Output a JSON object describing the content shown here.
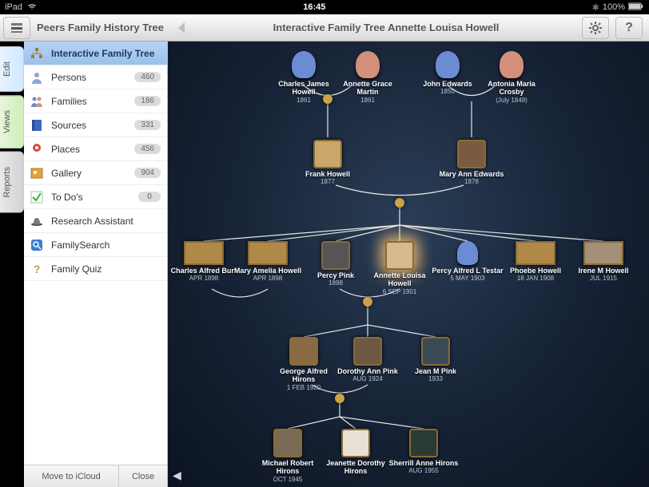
{
  "status": {
    "carrier": "iPad",
    "time": "16:45",
    "battery": "100%"
  },
  "toolbar": {
    "left_title": "Peers Family History Tree",
    "center_title": "Interactive Family Tree Annette Louisa Howell"
  },
  "sidetabs": [
    {
      "label": "Edit"
    },
    {
      "label": "Views"
    },
    {
      "label": "Reports"
    }
  ],
  "sidebar": {
    "items": [
      {
        "label": "Interactive Family Tree",
        "icon": "tree-icon",
        "badge": "",
        "selected": true
      },
      {
        "label": "Persons",
        "icon": "person-icon",
        "badge": "460",
        "selected": false
      },
      {
        "label": "Families",
        "icon": "people-icon",
        "badge": "186",
        "selected": false
      },
      {
        "label": "Sources",
        "icon": "book-icon",
        "badge": "331",
        "selected": false
      },
      {
        "label": "Places",
        "icon": "pin-icon",
        "badge": "456",
        "selected": false
      },
      {
        "label": "Gallery",
        "icon": "photo-icon",
        "badge": "904",
        "selected": false
      },
      {
        "label": "To Do's",
        "icon": "check-icon",
        "badge": "0",
        "selected": false
      },
      {
        "label": "Research Assistant",
        "icon": "hat-icon",
        "badge": "",
        "selected": false
      },
      {
        "label": "FamilySearch",
        "icon": "search-icon",
        "badge": "",
        "selected": false
      },
      {
        "label": "Family Quiz",
        "icon": "question-icon",
        "badge": "",
        "selected": false
      }
    ],
    "bottom": {
      "move": "Move to iCloud",
      "close": "Close"
    }
  },
  "tree": {
    "gen1": [
      {
        "name": "Charles James Howell",
        "date": "1861",
        "sex": "m"
      },
      {
        "name": "Annette Grace Martin",
        "date": "1861",
        "sex": "f"
      },
      {
        "name": "John Edwards",
        "date": "1850",
        "sex": "m"
      },
      {
        "name": "Antonia Maria Crosby",
        "date": "(July 1849)",
        "sex": "f"
      }
    ],
    "gen2": [
      {
        "name": "Frank Howell",
        "date": "1877"
      },
      {
        "name": "Mary Ann Edwards",
        "date": "1878"
      }
    ],
    "gen3": [
      {
        "name": "Charles Alfred Burr",
        "date": "APR 1898"
      },
      {
        "name": "Mary Amelia Howell",
        "date": "APR 1898"
      },
      {
        "name": "Percy Pink",
        "date": "1898"
      },
      {
        "name": "Annette Louisa Howell",
        "date": "6 SEP 1901"
      },
      {
        "name": "Percy Alfred L Testar",
        "date": "5 MAY 1903"
      },
      {
        "name": "Phoebe Howell",
        "date": "18 JAN 1908"
      },
      {
        "name": "Irene M Howell",
        "date": "JUL 1915"
      }
    ],
    "gen4": [
      {
        "name": "George Alfred Hirons",
        "date": "1 FEB 1920"
      },
      {
        "name": "Dorothy Ann Pink",
        "date": "AUG 1924"
      },
      {
        "name": "Jean M Pink",
        "date": "1933"
      }
    ],
    "gen5": [
      {
        "name": "Michael Robert Hirons",
        "date": "OCT 1945"
      },
      {
        "name": "Jeanette Dorothy Hirons",
        "date": ""
      },
      {
        "name": "Sherrill Anne Hirons",
        "date": "AUG 1955"
      }
    ]
  }
}
